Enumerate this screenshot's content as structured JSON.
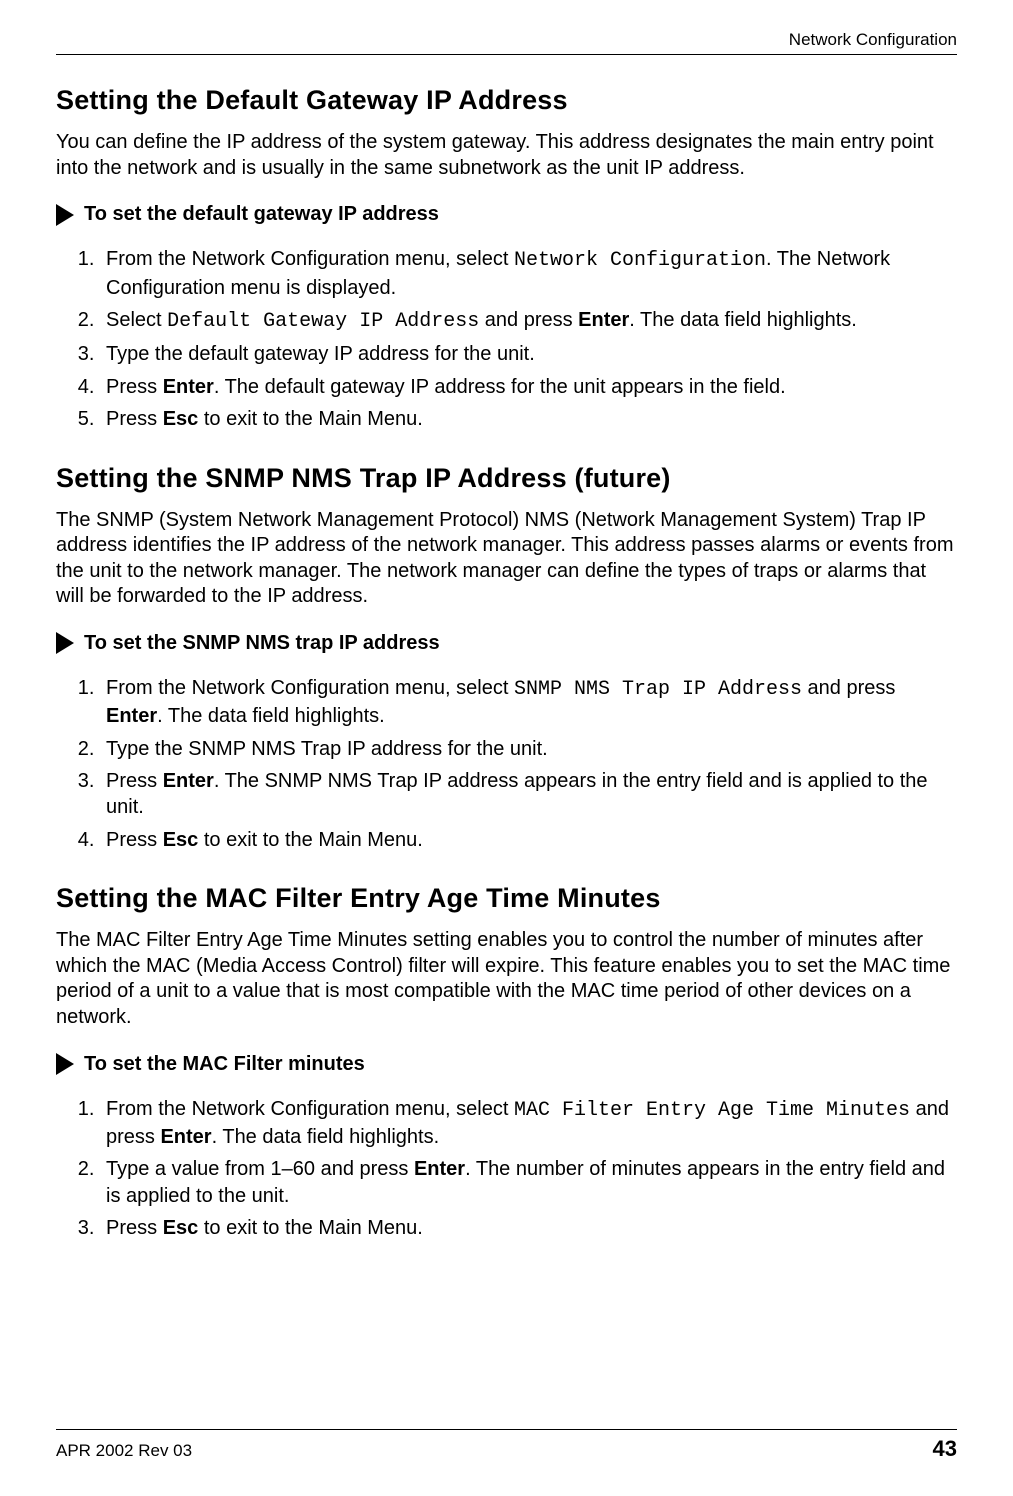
{
  "header": {
    "running": "Network Configuration"
  },
  "footer": {
    "left": "APR 2002 Rev 03",
    "page": "43"
  },
  "sec1": {
    "title": "Setting the Default Gateway IP Address",
    "intro": "You can define the IP address of the system gateway. This address designates the main entry point into the network and is usually in the same subnetwork as the unit IP address.",
    "proc_title": "To set the default gateway IP address",
    "steps": {
      "s1a": "From the Network Configuration menu, select ",
      "s1code": "Network Configuration",
      "s1b": ". The Network Configuration menu is displayed.",
      "s2a": "Select ",
      "s2code": "Default Gateway IP Address",
      "s2b": " and press ",
      "s2key": "Enter",
      "s2c": ". The data field highlights.",
      "s3": "Type the default gateway IP address for the unit.",
      "s4a": "Press ",
      "s4key": "Enter",
      "s4b": ". The default gateway IP address for the unit appears in the field.",
      "s5a": "Press ",
      "s5key": "Esc",
      "s5b": " to exit to the Main Menu."
    }
  },
  "sec2": {
    "title": "Setting the SNMP NMS Trap IP Address (future)",
    "intro": "The SNMP (System Network Management Protocol) NMS (Network Management System) Trap IP address identifies the IP address of the network manager. This address passes alarms or events from the unit to the network manager. The network manager can define the types of traps or alarms that will be forwarded to the IP address.",
    "proc_title": "To set the SNMP NMS trap IP address",
    "steps": {
      "s1a": "From the Network Configuration menu, select ",
      "s1code": "SNMP NMS Trap IP Address",
      "s1b": " and press ",
      "s1key": "Enter",
      "s1c": ". The data field highlights.",
      "s2": "Type the SNMP NMS Trap IP address for the unit.",
      "s3a": "Press ",
      "s3key": "Enter",
      "s3b": ". The SNMP NMS Trap IP address appears in the entry field and is applied to the unit.",
      "s4a": "Press ",
      "s4key": "Esc",
      "s4b": " to exit to the Main Menu."
    }
  },
  "sec3": {
    "title": "Setting the MAC Filter Entry Age Time Minutes",
    "intro": "The MAC Filter Entry Age Time Minutes setting enables you to control the number of minutes after which the MAC (Media Access Control) filter will expire. This feature enables you to set the MAC time period of a unit to a value that is most compatible with the MAC time period of other devices on a network.",
    "proc_title": "To set the MAC Filter minutes",
    "steps": {
      "s1a": "From the Network Configuration menu, select ",
      "s1code": "MAC Filter Entry Age Time Minutes",
      "s1b": " and press ",
      "s1key": "Enter",
      "s1c": ". The data field highlights.",
      "s2a": "Type a value from 1–60 and press ",
      "s2key": "Enter",
      "s2b": ". The number of minutes appears in the entry field and is applied to the unit.",
      "s3a": "Press ",
      "s3key": "Esc",
      "s3b": " to exit to the Main Menu."
    }
  }
}
